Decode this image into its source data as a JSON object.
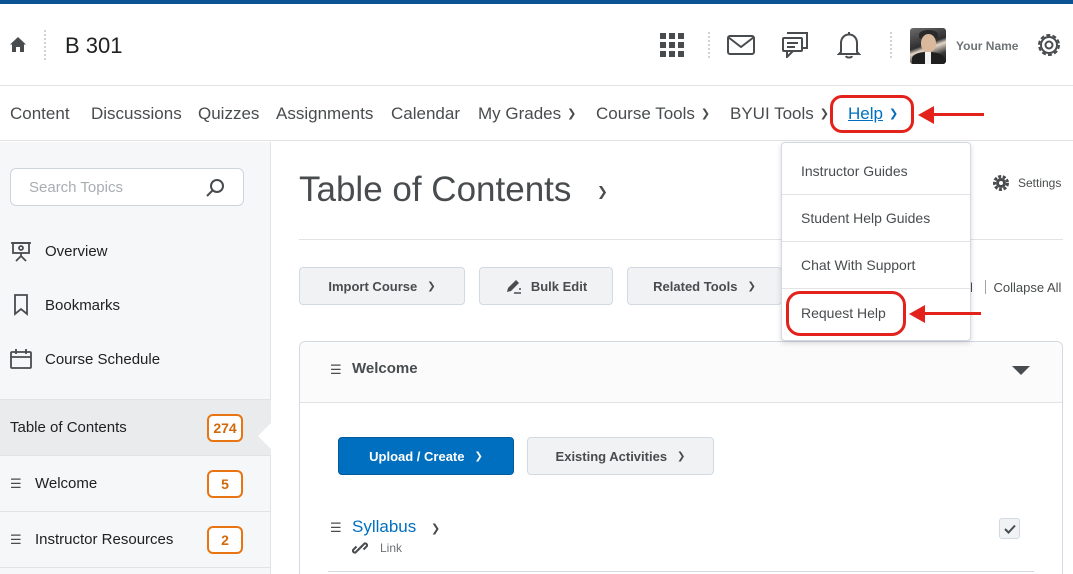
{
  "header": {
    "course_title": "B 301",
    "user_name": "Your Name"
  },
  "nav": {
    "items": [
      {
        "label": "Content",
        "has_menu": false
      },
      {
        "label": "Discussions",
        "has_menu": false
      },
      {
        "label": "Quizzes",
        "has_menu": false
      },
      {
        "label": "Assignments",
        "has_menu": false
      },
      {
        "label": "Calendar",
        "has_menu": false
      },
      {
        "label": "My Grades",
        "has_menu": true
      },
      {
        "label": "Course Tools",
        "has_menu": true
      },
      {
        "label": "BYUI Tools",
        "has_menu": true
      },
      {
        "label": "Help",
        "has_menu": true,
        "open": true
      }
    ]
  },
  "help_menu": {
    "items": [
      "Instructor Guides",
      "Student Help Guides",
      "Chat With Support",
      "Request Help"
    ]
  },
  "sidebar": {
    "search_placeholder": "Search Topics",
    "links": [
      {
        "label": "Overview",
        "icon": "presentation-icon"
      },
      {
        "label": "Bookmarks",
        "icon": "bookmark-icon"
      },
      {
        "label": "Course Schedule",
        "icon": "calendar-icon"
      }
    ],
    "toc": {
      "label": "Table of Contents",
      "count": "274"
    },
    "modules": [
      {
        "label": "Welcome",
        "count": "5"
      },
      {
        "label": "Instructor Resources",
        "count": "2"
      }
    ]
  },
  "main": {
    "title": "Table of Contents",
    "settings_label": "Settings",
    "toolbar": {
      "import_course": "Import Course",
      "bulk_edit": "Bulk Edit",
      "related_tools": "Related Tools",
      "expand_fragment": "l",
      "collapse_all": "Collapse All"
    },
    "module": {
      "title": "Welcome",
      "upload_create": "Upload / Create",
      "existing_activities": "Existing Activities",
      "topic": {
        "title": "Syllabus",
        "type": "Link"
      }
    }
  },
  "colors": {
    "accent": "#006fbf",
    "badge": "#e87511",
    "annotation": "#e3221b",
    "top_strip": "#0b5394"
  }
}
